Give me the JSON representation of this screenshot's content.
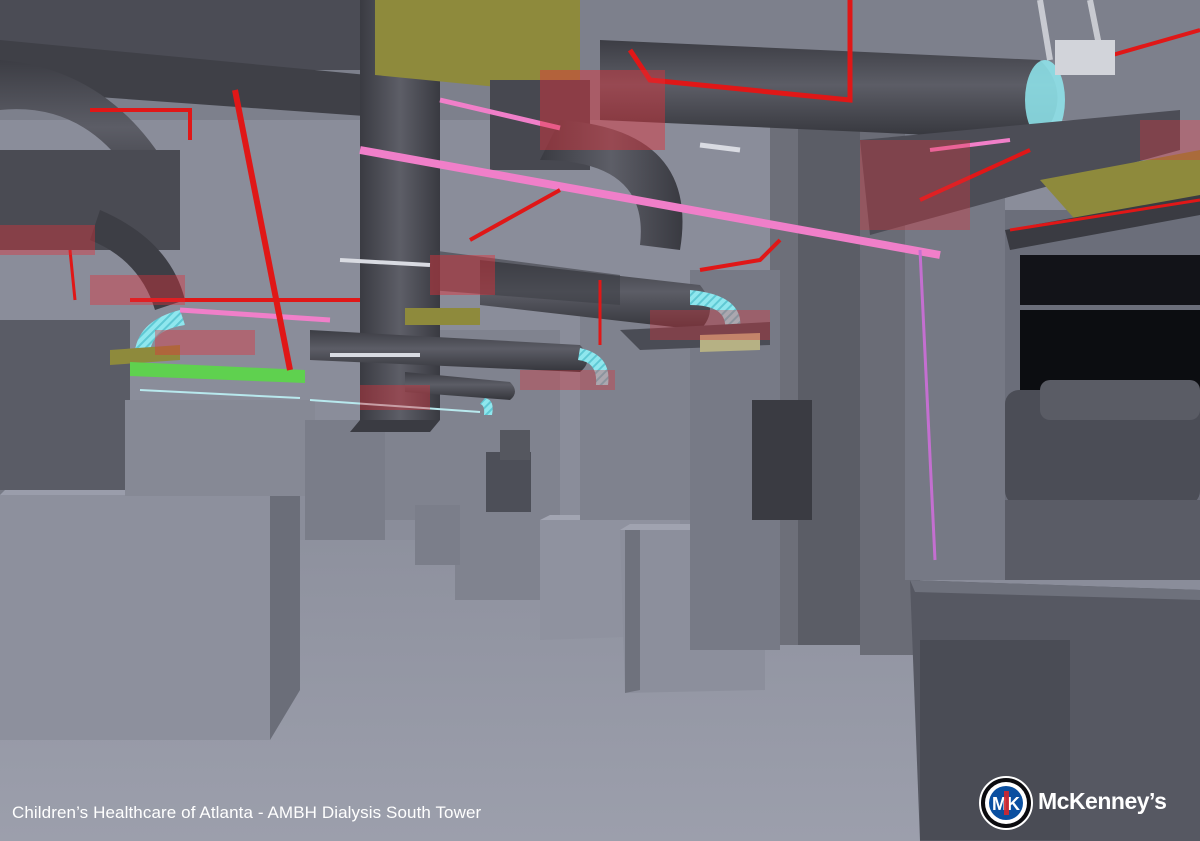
{
  "caption": "Children’s Healthcare of Atlanta - AMBH Dialysis South Tower",
  "logo": {
    "monogram": "MK",
    "wordmark": "McKenney’s",
    "icon": "mckenneys-logo-icon"
  },
  "colors": {
    "duct": "#4b4c55",
    "pipe_red": "#e01717",
    "pipe_pink": "#f07fc9",
    "flex_duct": "#8fe7ee",
    "clash_highlight": "#e0303a",
    "wall": "#8b8e9c",
    "floor": "#9699a6",
    "logo_blue": "#0a4fa0",
    "logo_red": "#d4262c"
  }
}
